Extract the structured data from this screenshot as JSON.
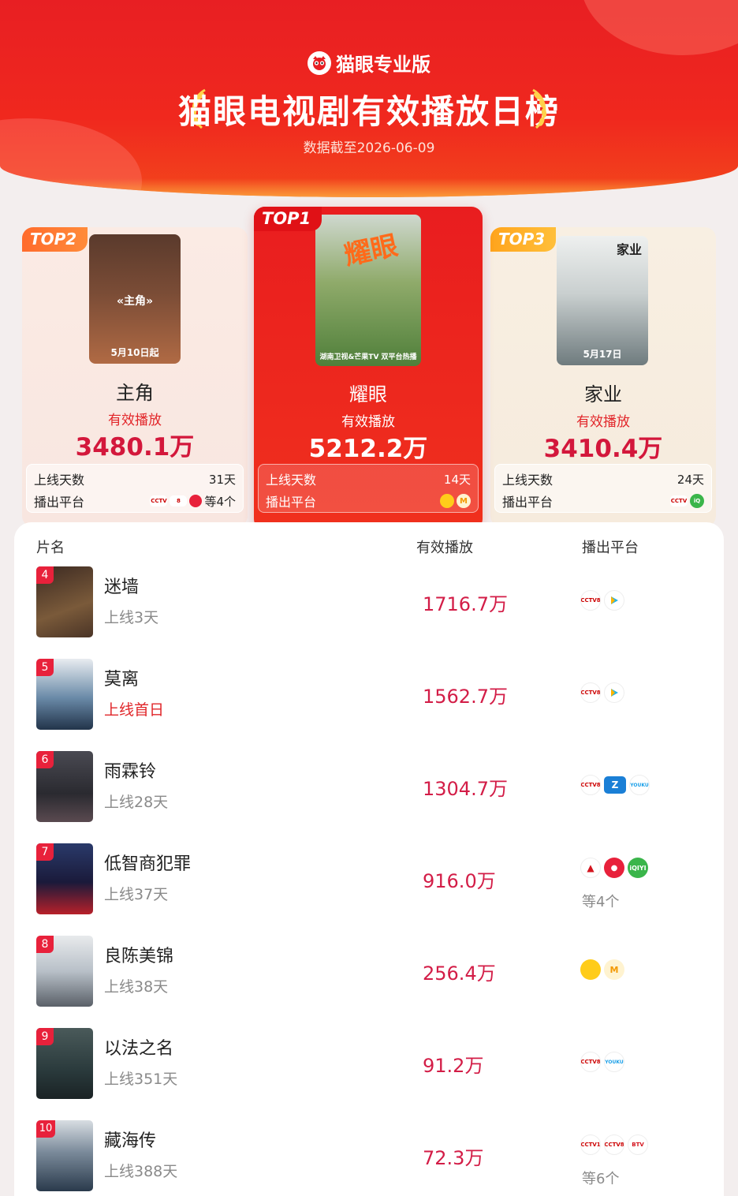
{
  "header": {
    "brand": "猫眼专业版",
    "title": "猫眼电视剧有效播放日榜",
    "date_line": "数据截至2026-06-09"
  },
  "colors": {
    "primary_red": "#e81f23",
    "value_red": "#d31d47",
    "gold": "#ffa41c"
  },
  "top3": [
    {
      "tag": "TOP2",
      "name": "主角",
      "label": "有效播放",
      "value": "3480.1万",
      "poster_text": "5月10日起",
      "poster_title": "«主角»",
      "days_label": "上线天数",
      "days": "31天",
      "platform_label": "播出平台",
      "platform_more": "等4个",
      "platform_icons": [
        "cctv-icon",
        "cctv8-icon",
        "redcircle-icon"
      ]
    },
    {
      "tag": "TOP1",
      "name": "耀眼",
      "label": "有效播放",
      "value": "5212.2万",
      "poster_text": "湖南卫视&芒果TV 双平台热播",
      "poster_title": "耀眼",
      "days_label": "上线天数",
      "days": "14天",
      "platform_label": "播出平台",
      "platform_more": "",
      "platform_icons": [
        "hunan-tv-icon",
        "mango-tv-icon"
      ]
    },
    {
      "tag": "TOP3",
      "name": "家业",
      "label": "有效播放",
      "value": "3410.4万",
      "poster_text": "5月17日",
      "poster_title": "家业",
      "days_label": "上线天数",
      "days": "24天",
      "platform_label": "播出平台",
      "platform_more": "",
      "platform_icons": [
        "cctv-icon",
        "iqiyi-icon"
      ]
    }
  ],
  "table": {
    "col_title": "片名",
    "col_views": "有效播放",
    "col_platform": "播出平台",
    "rows": [
      {
        "rank": "4",
        "title": "迷墙",
        "days": "上线3天",
        "views": "1716.7万",
        "platforms": [
          "cctv8-icon",
          "tencent-video-icon"
        ],
        "more": ""
      },
      {
        "rank": "5",
        "title": "莫离",
        "days": "上线首日",
        "views": "1562.7万",
        "platforms": [
          "cctv8-icon",
          "tencent-video-icon"
        ],
        "more": ""
      },
      {
        "rank": "6",
        "title": "雨霖铃",
        "days": "上线28天",
        "views": "1304.7万",
        "platforms": [
          "cctv8-icon",
          "zhejiang-tv-icon",
          "youku-icon"
        ],
        "more": ""
      },
      {
        "rank": "7",
        "title": "低智商犯罪",
        "days": "上线37天",
        "views": "916.0万",
        "platforms": [
          "dragon-tv-icon",
          "redcircle-icon",
          "iqiyi-icon"
        ],
        "more": "等4个"
      },
      {
        "rank": "8",
        "title": "良陈美锦",
        "days": "上线38天",
        "views": "256.4万",
        "platforms": [
          "hunan-tv-icon",
          "mango-tv-icon"
        ],
        "more": ""
      },
      {
        "rank": "9",
        "title": "以法之名",
        "days": "上线351天",
        "views": "91.2万",
        "platforms": [
          "cctv8-icon",
          "youku-icon"
        ],
        "more": ""
      },
      {
        "rank": "10",
        "title": "藏海传",
        "days": "上线388天",
        "views": "72.3万",
        "platforms": [
          "cctv1-icon",
          "cctv8-icon",
          "btv-icon"
        ],
        "more": "等6个"
      }
    ]
  }
}
